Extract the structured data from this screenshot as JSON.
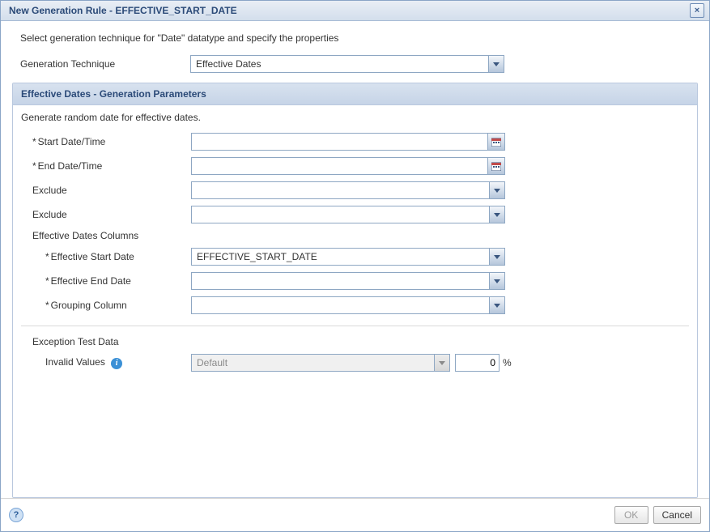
{
  "dialog": {
    "title": "New Generation Rule - EFFECTIVE_START_DATE",
    "close_glyph": "×"
  },
  "intro": "Select generation technique for \"Date\" datatype and specify the properties",
  "generation_technique": {
    "label": "Generation Technique",
    "value": "Effective Dates"
  },
  "section": {
    "title": "Effective Dates - Generation Parameters",
    "description": "Generate random date for effective dates.",
    "start_date": {
      "label": "Start Date/Time",
      "value": ""
    },
    "end_date": {
      "label": "End Date/Time",
      "value": ""
    },
    "exclude1": {
      "label": "Exclude",
      "value": ""
    },
    "exclude2": {
      "label": "Exclude",
      "value": ""
    },
    "columns_heading": "Effective Dates Columns",
    "eff_start_col": {
      "label": "Effective Start Date",
      "value": "EFFECTIVE_START_DATE"
    },
    "eff_end_col": {
      "label": "Effective End Date",
      "value": ""
    },
    "grouping_col": {
      "label": "Grouping Column",
      "value": ""
    },
    "exception_heading": "Exception Test Data",
    "invalid_values": {
      "label": "Invalid Values",
      "combo_value": "Default",
      "percent_value": "0",
      "percent_suffix": "%"
    }
  },
  "footer": {
    "help_glyph": "?",
    "ok_label": "OK",
    "cancel_label": "Cancel"
  }
}
